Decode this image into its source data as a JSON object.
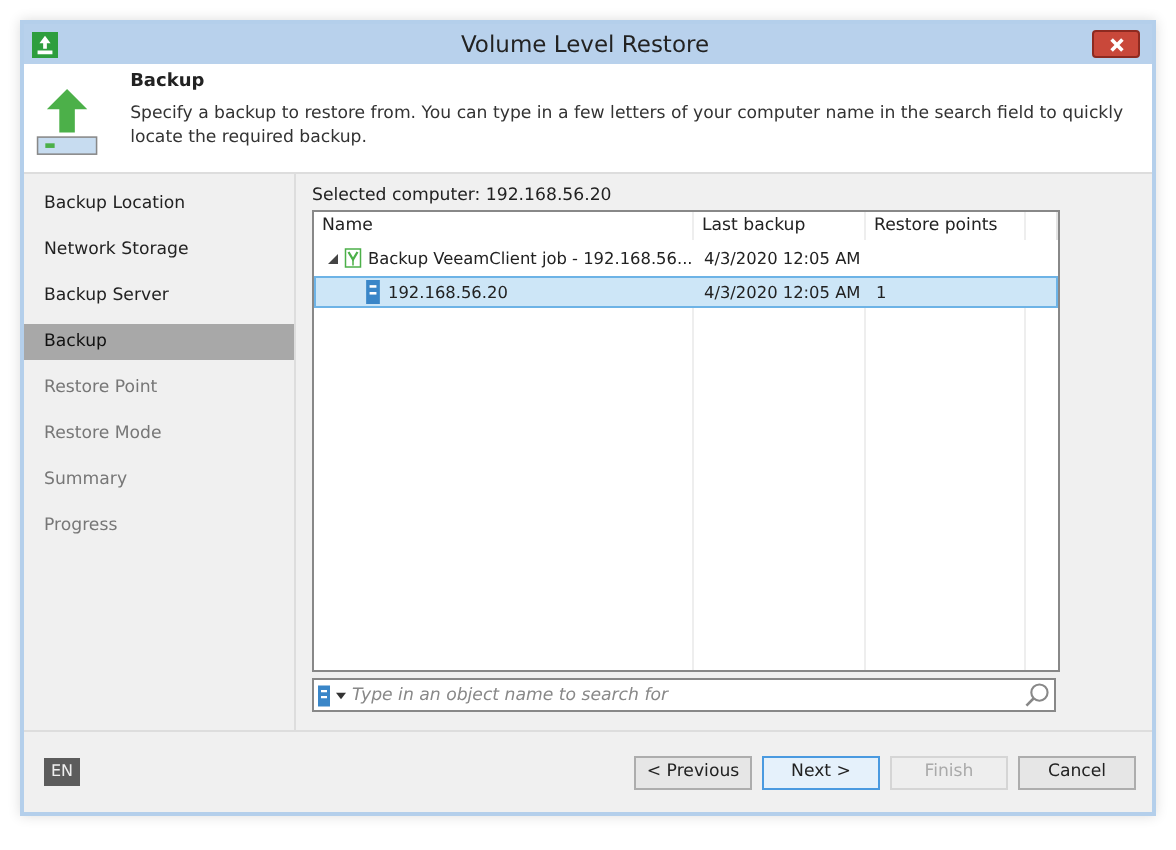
{
  "window": {
    "title": "Volume Level Restore"
  },
  "header": {
    "title": "Backup",
    "description": "Specify a backup to restore from. You can type in a few letters of your computer name in the search field to quickly locate the required backup."
  },
  "steps": [
    {
      "label": "Backup Location",
      "selected": false,
      "disabled": false
    },
    {
      "label": "Network Storage",
      "selected": false,
      "disabled": false
    },
    {
      "label": "Backup Server",
      "selected": false,
      "disabled": false
    },
    {
      "label": "Backup",
      "selected": true,
      "disabled": false
    },
    {
      "label": "Restore Point",
      "selected": false,
      "disabled": true
    },
    {
      "label": "Restore Mode",
      "selected": false,
      "disabled": true
    },
    {
      "label": "Summary",
      "selected": false,
      "disabled": true
    },
    {
      "label": "Progress",
      "selected": false,
      "disabled": true
    }
  ],
  "selected_computer": "Selected computer: 192.168.56.20",
  "table": {
    "columns": [
      "Name",
      "Last backup",
      "Restore points"
    ],
    "rows": [
      {
        "name": "Backup VeeamClient job - 192.168.56...",
        "last_backup": "4/3/2020 12:05 AM",
        "expanded": true,
        "selected": false,
        "children": [
          {
            "name": "192.168.56.20",
            "last_backup": "4/3/2020 12:05 AM",
            "restore_points": "1",
            "selected": true
          }
        ]
      }
    ]
  },
  "search": {
    "placeholder": "Type in an object name to search for"
  },
  "language": "EN",
  "buttons": [
    {
      "label": "< Previous",
      "disabled": false,
      "focused": false
    },
    {
      "label": "Next >",
      "disabled": false,
      "focused": true
    },
    {
      "label": "Finish",
      "disabled": true,
      "focused": false
    },
    {
      "label": "Cancel",
      "disabled": false,
      "focused": false
    }
  ]
}
